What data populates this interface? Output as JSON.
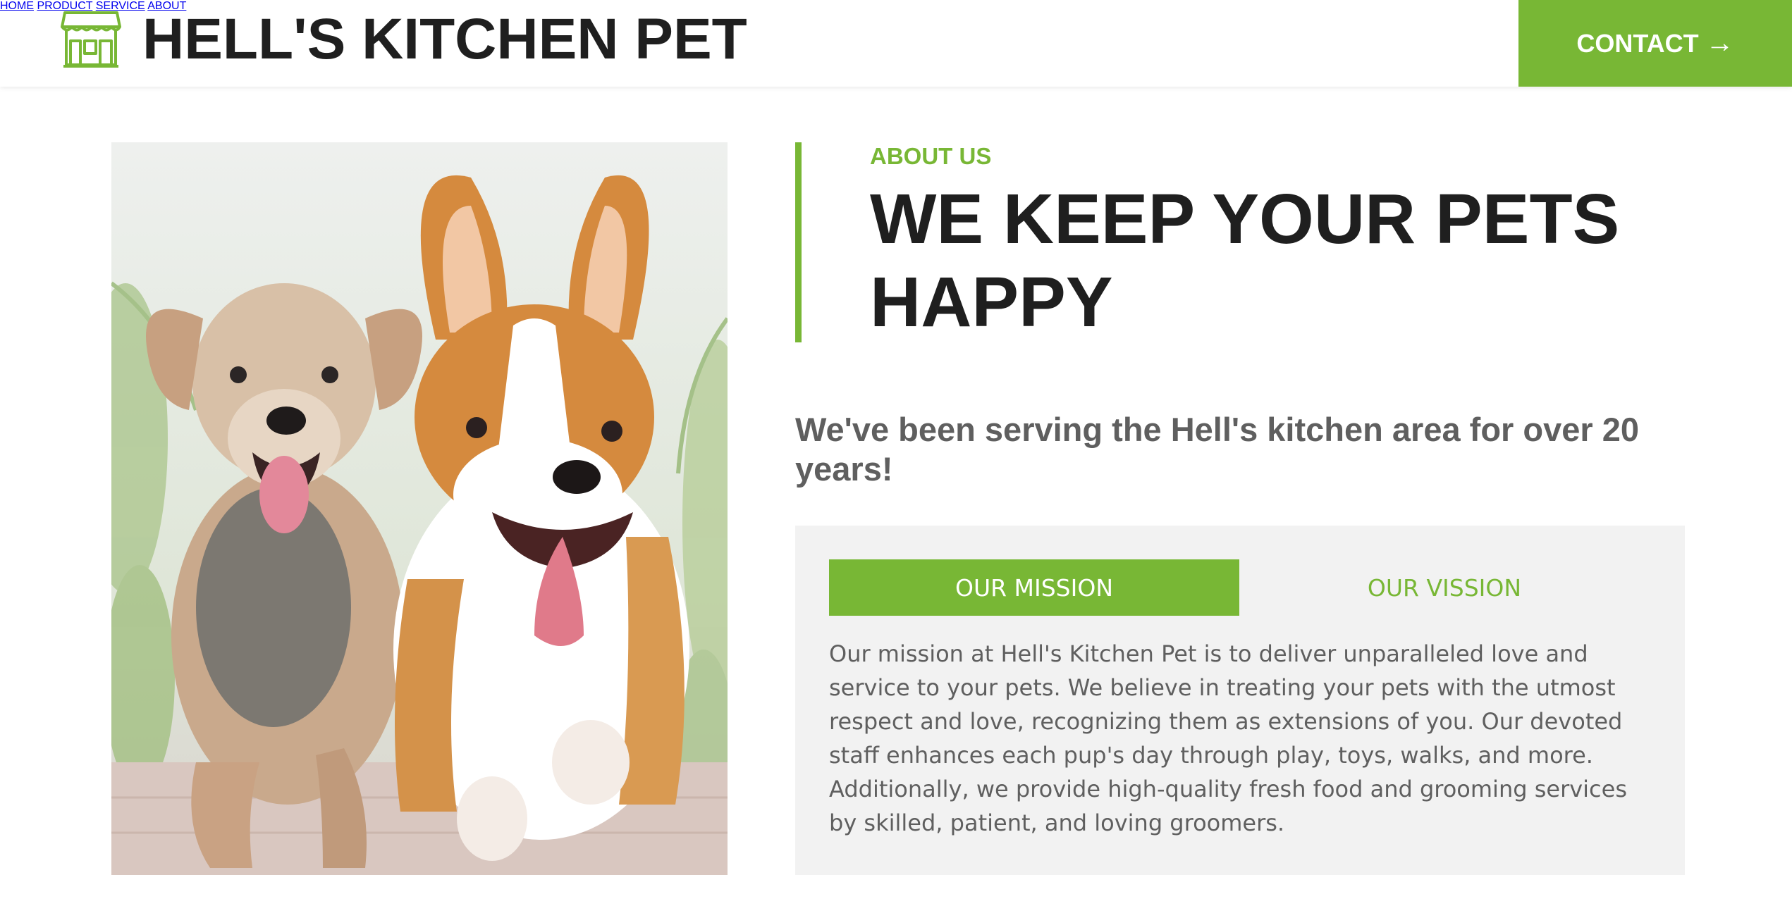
{
  "header": {
    "brand_name": "HELL'S KITCHEN PET",
    "logo_icon": "storefront-icon",
    "nav": [
      "HOME",
      "PRODUCT",
      "SERVICE",
      "ABOUT"
    ],
    "contact_label": "CONTACT",
    "contact_icon": "arrow-right-icon"
  },
  "hero_image": {
    "icon": "two-dogs-photo"
  },
  "about": {
    "eyebrow": "ABOUT US",
    "headline": "WE KEEP YOUR PETS HAPPY",
    "subhead": "We've been serving the Hell's kitchen area for over 20 years!",
    "tabs": [
      {
        "label": "OUR MISSION",
        "active": true
      },
      {
        "label": "OUR VISSION",
        "active": false
      }
    ],
    "mission_text": "Our mission at Hell's Kitchen Pet is to deliver unparalleled love and service to your pets. We believe in treating your pets with the utmost respect and love, recognizing them as extensions of you. Our devoted staff enhances each pup's day through play, toys, walks, and more. Additionally, we provide high-quality fresh food and grooming services by skilled, patient, and loving groomers."
  },
  "colors": {
    "accent": "#78b735",
    "text_dark": "#1f1f1f",
    "text_gray": "#5f5f5f",
    "panel_bg": "#f2f2f2"
  }
}
